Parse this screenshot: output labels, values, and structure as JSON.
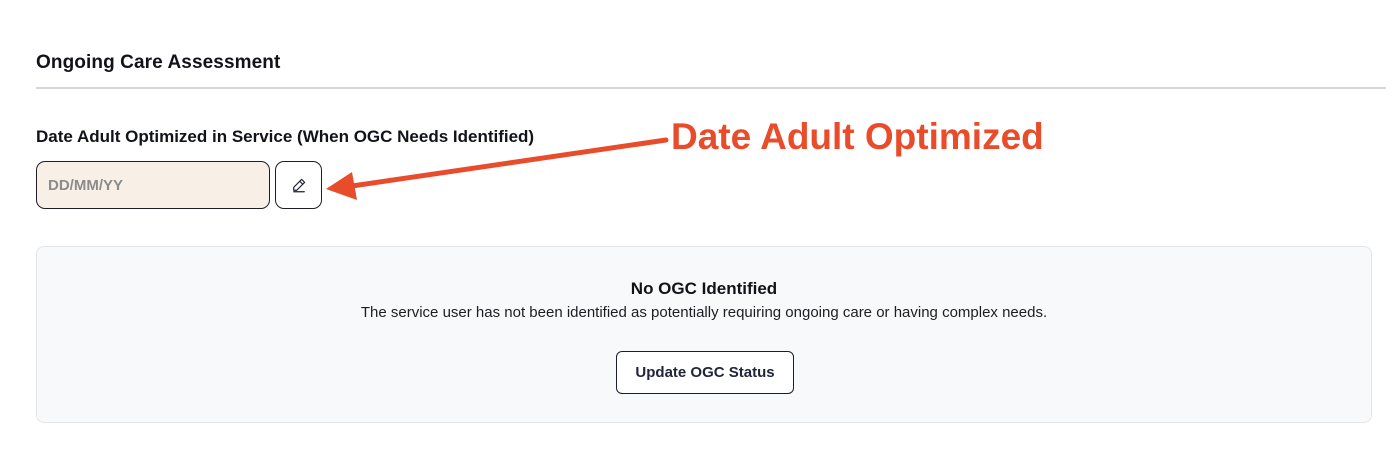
{
  "section": {
    "title": "Ongoing Care Assessment"
  },
  "date_field": {
    "label": "Date Adult Optimized in Service (When OGC Needs Identified)",
    "value": "",
    "placeholder": "DD/MM/YY",
    "edit_icon": "pencil-icon"
  },
  "annotation": {
    "text": "Date Adult Optimized",
    "color": "#e84c2a"
  },
  "ogc_panel": {
    "title": "No OGC Identified",
    "description": "The service user has not been identified as potentially requiring ongoing care or having complex needs.",
    "button_label": "Update OGC Status"
  },
  "colors": {
    "input_background": "#f8f0e7",
    "panel_background": "#f8f9fb",
    "border": "#1c1e2b"
  }
}
